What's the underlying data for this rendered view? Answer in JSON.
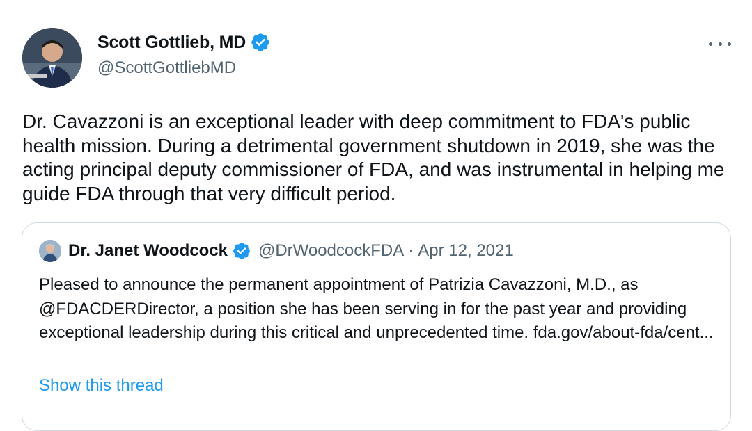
{
  "author": {
    "name": "Scott Gottlieb, MD",
    "handle": "@ScottGottliebMD",
    "verified": true,
    "avatar_icon": "profile-photo"
  },
  "tweet": {
    "text": "Dr. Cavazzoni is an exceptional leader with deep commitment to FDA's public health mission. During a detrimental government shutdown in 2019, she was the acting principal deputy commissioner of FDA, and was instrumental in helping me guide FDA through that very difficult period."
  },
  "quoted_tweet": {
    "name": "Dr. Janet Woodcock",
    "handle": "@DrWoodcockFDA",
    "separator": "·",
    "date": "Apr 12, 2021",
    "verified": true,
    "text": "Pleased to announce the permanent appointment of Patrizia Cavazzoni, M.D., as @FDACDERDirector, a position she has been serving in for the past year and providing exceptional leadership during this critical and unprecedented time. fda.gov/about-fda/cent...",
    "show_thread_label": "Show this thread"
  },
  "colors": {
    "verified_blue": "#1d9bf0",
    "secondary_text": "#536471",
    "primary_text": "#0f1419",
    "border": "#cfd9de",
    "link": "#1d9bf0"
  },
  "icons": {
    "more": "more-horizontal-icon",
    "verified": "verified-badge-icon"
  }
}
